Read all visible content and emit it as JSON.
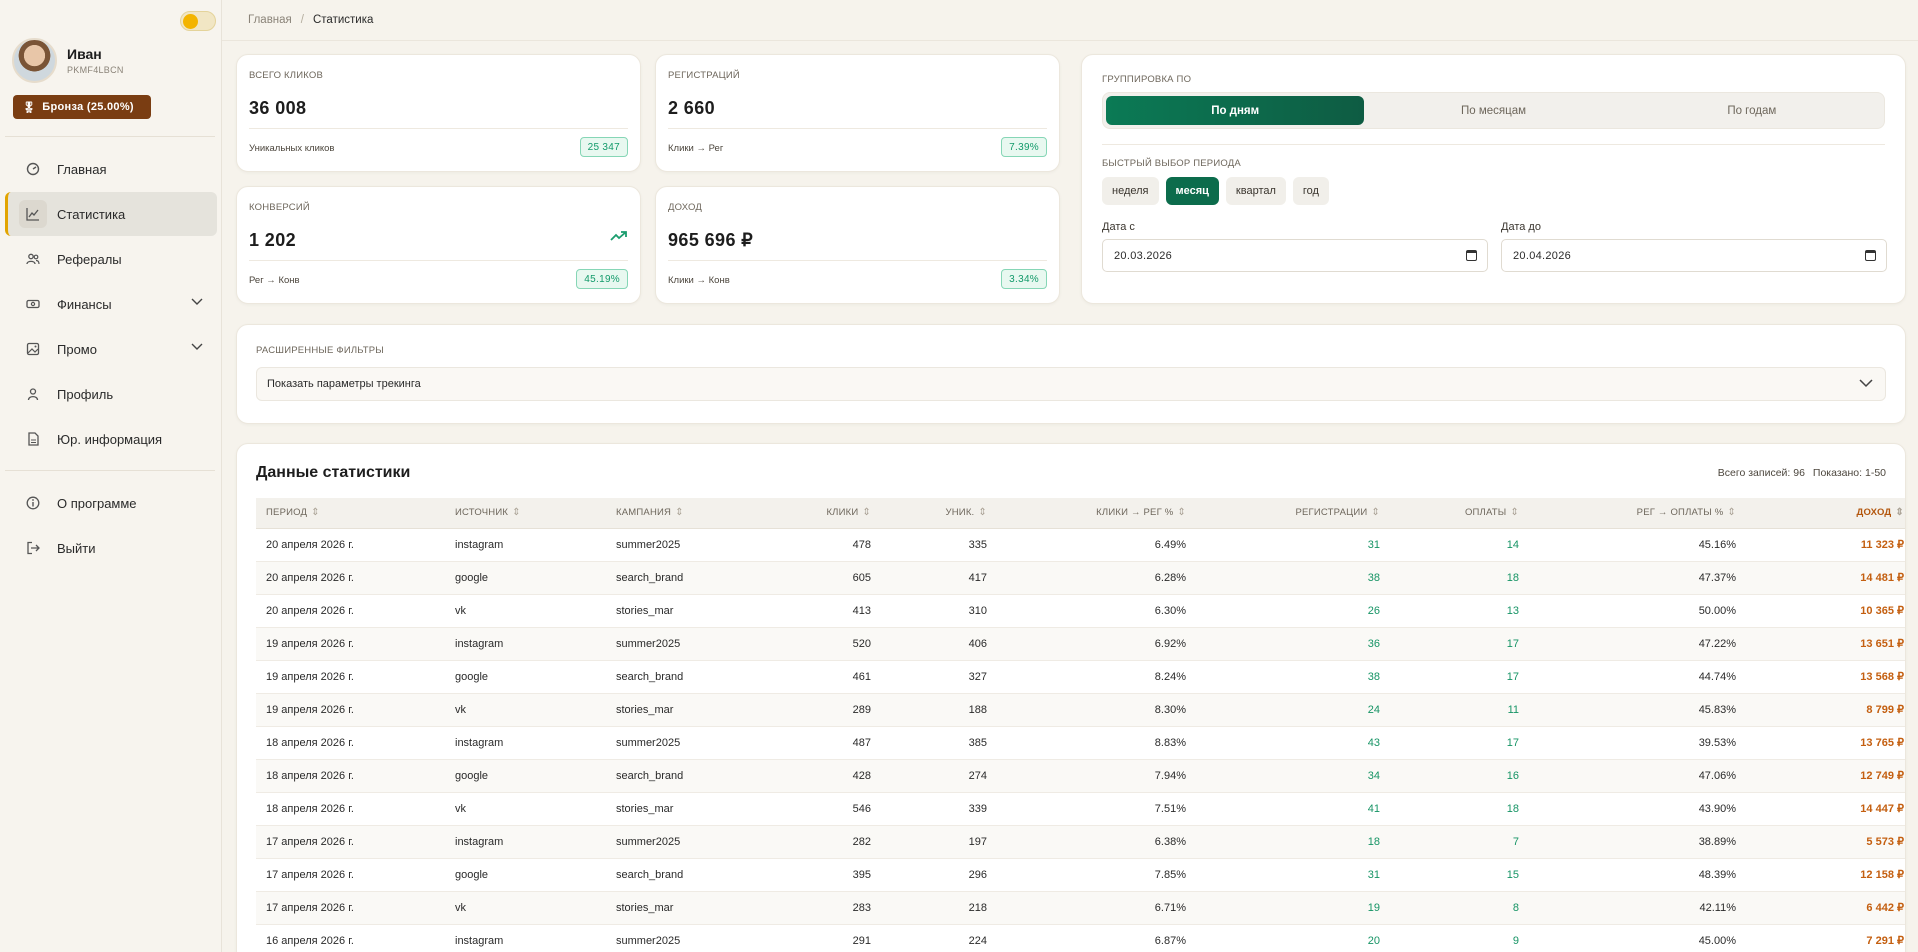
{
  "user": {
    "name": "Иван",
    "code": "PKMF4LBCN",
    "tier": "Бронза (25.00%)"
  },
  "nav": {
    "items": [
      {
        "label": "Главная",
        "icon": "dashboard-icon"
      },
      {
        "label": "Статистика",
        "icon": "chart-icon",
        "active": true
      },
      {
        "label": "Рефералы",
        "icon": "users-icon"
      },
      {
        "label": "Финансы",
        "icon": "money-icon",
        "expandable": true
      },
      {
        "label": "Промо",
        "icon": "image-icon",
        "expandable": true
      },
      {
        "label": "Профиль",
        "icon": "user-icon"
      },
      {
        "label": "Юр. информация",
        "icon": "document-icon"
      }
    ],
    "bottom": [
      {
        "label": "О программе",
        "icon": "info-icon"
      },
      {
        "label": "Выйти",
        "icon": "logout-icon"
      }
    ]
  },
  "breadcrumb": {
    "home": "Главная",
    "current": "Статистика"
  },
  "stats": {
    "clicks": {
      "label": "Всего кликов",
      "value": "36 008",
      "sub": "Уникальных кликов",
      "badge": "25 347"
    },
    "regs": {
      "label": "Регистраций",
      "value": "2 660",
      "sub": "Клики → Рег",
      "badge": "7.39%"
    },
    "conv": {
      "label": "Конверсий",
      "value": "1 202",
      "sub": "Рег → Конв",
      "badge": "45.19%"
    },
    "income": {
      "label": "Доход",
      "value": "965 696 ₽",
      "sub": "Клики → Конв",
      "badge": "3.34%"
    }
  },
  "grouping": {
    "label": "Группировка по",
    "options": [
      "По дням",
      "По месяцам",
      "По годам"
    ],
    "selected": "По дням"
  },
  "period": {
    "label": "Быстрый выбор периода",
    "options": [
      "неделя",
      "месяц",
      "квартал",
      "год"
    ],
    "selected": "месяц",
    "from_label": "Дата с",
    "from_value": "20.03.2026",
    "to_label": "Дата до",
    "to_value": "20.04.2026"
  },
  "filters": {
    "label": "Расширенные фильтры",
    "toggle": "Показать параметры трекинга"
  },
  "table": {
    "title": "Данные статистики",
    "total": "Всего записей: 96",
    "shown": "Показано: 1-50",
    "columns": [
      "Период",
      "Источник",
      "Кампания",
      "Клики",
      "Уник.",
      "Клики → Рег %",
      "Регистрации",
      "Оплаты",
      "Рег → Оплаты %",
      "Доход"
    ],
    "rows": [
      [
        "20 апреля 2026 г.",
        "instagram",
        "summer2025",
        "478",
        "335",
        "6.49%",
        "31",
        "14",
        "45.16%",
        "11 323 ₽"
      ],
      [
        "20 апреля 2026 г.",
        "google",
        "search_brand",
        "605",
        "417",
        "6.28%",
        "38",
        "18",
        "47.37%",
        "14 481 ₽"
      ],
      [
        "20 апреля 2026 г.",
        "vk",
        "stories_mar",
        "413",
        "310",
        "6.30%",
        "26",
        "13",
        "50.00%",
        "10 365 ₽"
      ],
      [
        "19 апреля 2026 г.",
        "instagram",
        "summer2025",
        "520",
        "406",
        "6.92%",
        "36",
        "17",
        "47.22%",
        "13 651 ₽"
      ],
      [
        "19 апреля 2026 г.",
        "google",
        "search_brand",
        "461",
        "327",
        "8.24%",
        "38",
        "17",
        "44.74%",
        "13 568 ₽"
      ],
      [
        "19 апреля 2026 г.",
        "vk",
        "stories_mar",
        "289",
        "188",
        "8.30%",
        "24",
        "11",
        "45.83%",
        "8 799 ₽"
      ],
      [
        "18 апреля 2026 г.",
        "instagram",
        "summer2025",
        "487",
        "385",
        "8.83%",
        "43",
        "17",
        "39.53%",
        "13 765 ₽"
      ],
      [
        "18 апреля 2026 г.",
        "google",
        "search_brand",
        "428",
        "274",
        "7.94%",
        "34",
        "16",
        "47.06%",
        "12 749 ₽"
      ],
      [
        "18 апреля 2026 г.",
        "vk",
        "stories_mar",
        "546",
        "339",
        "7.51%",
        "41",
        "18",
        "43.90%",
        "14 447 ₽"
      ],
      [
        "17 апреля 2026 г.",
        "instagram",
        "summer2025",
        "282",
        "197",
        "6.38%",
        "18",
        "7",
        "38.89%",
        "5 573 ₽"
      ],
      [
        "17 апреля 2026 г.",
        "google",
        "search_brand",
        "395",
        "296",
        "7.85%",
        "31",
        "15",
        "48.39%",
        "12 158 ₽"
      ],
      [
        "17 апреля 2026 г.",
        "vk",
        "stories_mar",
        "283",
        "218",
        "6.71%",
        "19",
        "8",
        "42.11%",
        "6 442 ₽"
      ],
      [
        "16 апреля 2026 г.",
        "instagram",
        "summer2025",
        "291",
        "224",
        "6.87%",
        "20",
        "9",
        "45.00%",
        "7 291 ₽"
      ]
    ]
  }
}
